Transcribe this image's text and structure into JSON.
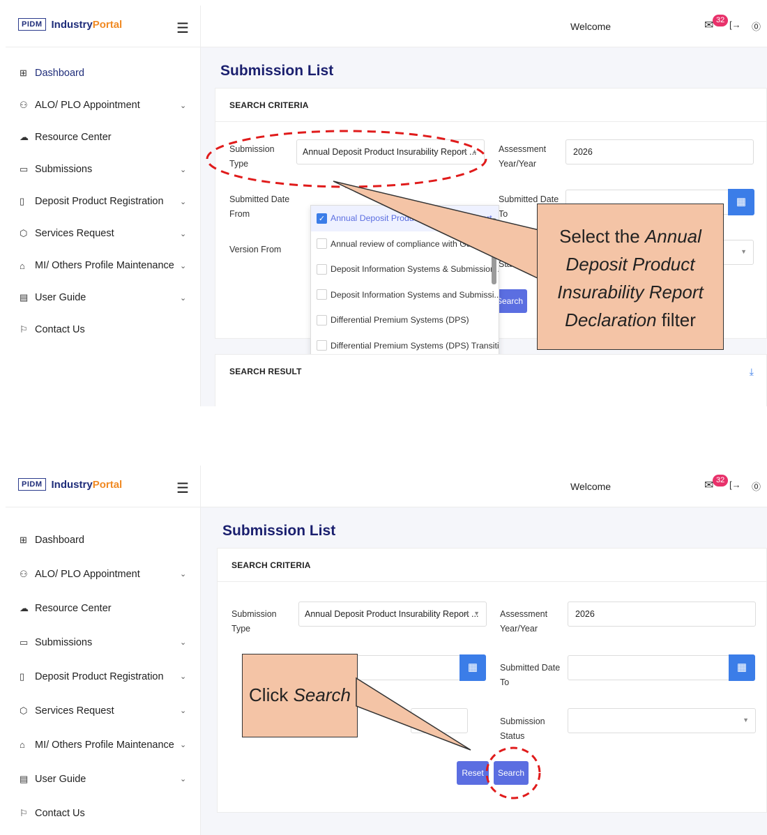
{
  "app": {
    "logo_badge": "PIDM",
    "logo_text_main": "Industry",
    "logo_text_accent": "Portal",
    "welcome": "Welcome",
    "mail_count": "32"
  },
  "sidebar": {
    "items": [
      {
        "label": "Dashboard",
        "icon": "dashboard-grid-icon"
      },
      {
        "label": "ALO/ PLO Appointment",
        "icon": "user-plus-icon"
      },
      {
        "label": "Resource Center",
        "icon": "cloud-download-icon"
      },
      {
        "label": "Submissions",
        "icon": "folder-icon"
      },
      {
        "label": "Deposit Product Registration",
        "icon": "document-icon"
      },
      {
        "label": "Services Request",
        "icon": "cube-icon"
      },
      {
        "label": "MI/ Others Profile Maintenance",
        "icon": "home-icon"
      },
      {
        "label": "User Guide",
        "icon": "guide-document-icon"
      },
      {
        "label": "Contact Us",
        "icon": "chat-flag-icon"
      }
    ]
  },
  "page": {
    "title": "Submission List",
    "search_criteria": "SEARCH CRITERIA",
    "search_result": "SEARCH RESULT"
  },
  "form": {
    "submission_type_label_1": "Submission",
    "submission_type_label_2": "Type",
    "submission_type_value": "Annual Deposit Product Insurability Report ...",
    "assessment_label_1": "Assessment",
    "assessment_label_2": "Year/Year",
    "assessment_value": "2026",
    "submitted_from_label_1": "Submitted Date",
    "submitted_from_label_2": "From",
    "submitted_to_label_1": "Submitted Date",
    "submitted_to_label_2": "To",
    "version_from_label": "Version From",
    "status_label_1": "Submission",
    "status_label_2": "Status",
    "reset_label": "Reset",
    "search_label": "Search"
  },
  "dropdown_options": [
    {
      "label": "Annual Deposit Product Insurability Report...",
      "checked": true
    },
    {
      "label": "Annual review of compliance with Guidelin...",
      "checked": false
    },
    {
      "label": "Deposit Information Systems & Submission...",
      "checked": false
    },
    {
      "label": "Deposit Information Systems and Submissi...",
      "checked": false
    },
    {
      "label": "Differential Premium Systems (DPS)",
      "checked": false
    },
    {
      "label": "Differential Premium Systems (DPS) Transiti...",
      "checked": false
    }
  ],
  "annotations": {
    "callout1_line1_plain": "Select the ",
    "callout1_line1_italic": "Annual",
    "callout1_line2": "Deposit Product",
    "callout1_line3": "Insurability Report",
    "callout1_line4_italic": "Declaration",
    "callout1_line4_plain": " filter",
    "callout2_plain": "Click ",
    "callout2_italic": "Search",
    "highlight_color": "#e01b1b",
    "callout_fill": "#f4c4a6"
  }
}
